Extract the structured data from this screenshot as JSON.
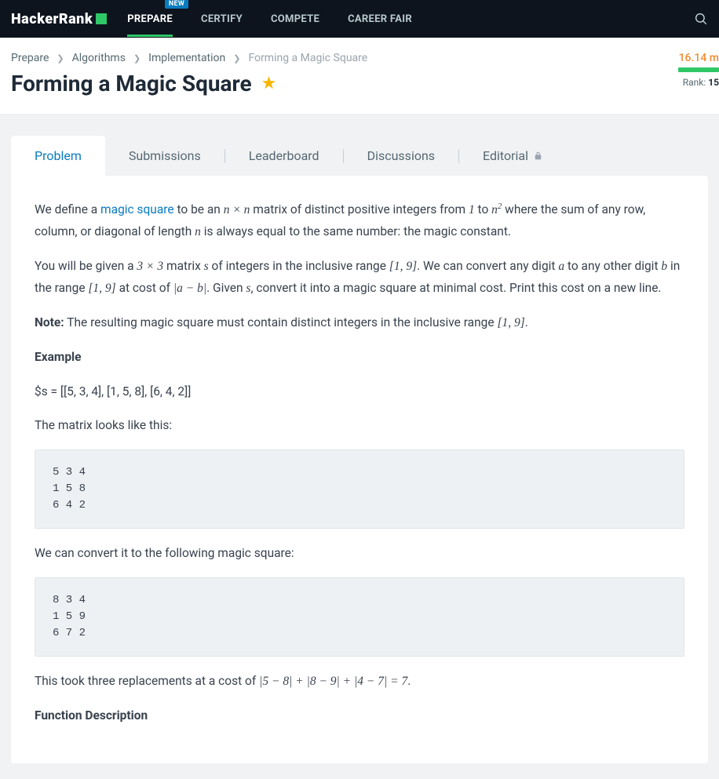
{
  "header": {
    "logo": "HackerRank",
    "nav": [
      {
        "label": "PREPARE",
        "active": true,
        "badge": "NEW"
      },
      {
        "label": "CERTIFY",
        "active": false
      },
      {
        "label": "COMPETE",
        "active": false
      },
      {
        "label": "CAREER FAIR",
        "active": false
      }
    ]
  },
  "breadcrumb": {
    "items": [
      "Prepare",
      "Algorithms",
      "Implementation"
    ],
    "current": "Forming a Magic Square"
  },
  "page": {
    "title": "Forming a Magic Square",
    "rank_progress": "16.14 m",
    "rank_label": "Rank:",
    "rank_value": "15"
  },
  "tabs": [
    "Problem",
    "Submissions",
    "Leaderboard",
    "Discussions",
    "Editorial"
  ],
  "problem": {
    "p1_a": "We define a ",
    "p1_link": "magic square",
    "p1_b": " to be an ",
    "p1_m1": "n × n",
    "p1_c": " matrix of distinct positive integers from ",
    "p1_m2": "1",
    "p1_d": " to ",
    "p1_m3_base": "n",
    "p1_m3_sup": "2",
    "p1_e": " where the sum of any row, column, or diagonal of length ",
    "p1_m4": "n",
    "p1_f": " is always equal to the same number: the magic constant.",
    "p2_a": "You will be given a ",
    "p2_m1": "3 × 3",
    "p2_b": " matrix ",
    "p2_m2": "s",
    "p2_c": " of integers in the inclusive range ",
    "p2_m3": "[1, 9]",
    "p2_d": ". We can convert any digit ",
    "p2_m4": "a",
    "p2_e": " to any other digit ",
    "p2_m5": "b",
    "p2_f": " in the range ",
    "p2_m6": "[1, 9]",
    "p2_g": " at cost of ",
    "p2_m7": "|a − b|",
    "p2_h": ". Given ",
    "p2_m8": "s",
    "p2_i": ", convert it into a magic square at minimal cost. Print this cost on a new line.",
    "note_label": "Note:",
    "note_text": " The resulting magic square must contain distinct integers in the inclusive range ",
    "note_m": "[1, 9]",
    "note_end": ".",
    "example_label": "Example",
    "example_s": "$s = [[5, 3, 4], [1, 5, 8], [6, 4, 2]]",
    "matrix_intro": "The matrix looks like this:",
    "matrix1": "5 3 4\n1 5 8\n6 4 2",
    "convert_intro": "We can convert it to the following magic square:",
    "matrix2": "8 3 4\n1 5 9\n6 7 2",
    "cost_a": "This took three replacements at a cost of ",
    "cost_m": "|5 − 8| + |8 − 9| + |4 − 7| = 7",
    "cost_b": ".",
    "func_desc": "Function Description"
  }
}
